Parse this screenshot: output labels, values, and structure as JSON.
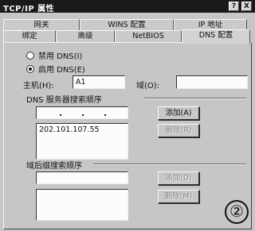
{
  "window": {
    "title": "TCP/IP 属性",
    "help_glyph": "?",
    "close_glyph": "X"
  },
  "tabs_back": [
    "网关",
    "WINS 配置",
    "IP 地址"
  ],
  "tabs_front": [
    "绑定",
    "高级",
    "NetBIOS",
    "DNS 配置"
  ],
  "dns": {
    "disable_label": "禁用 DNS(I)",
    "enable_label": "启用 DNS(E)",
    "enabled": true,
    "host_label": "主机(H):",
    "host_value": "A1",
    "domain_label": "域(O):",
    "domain_value": ""
  },
  "server_order": {
    "title": "DNS 服务器搜索顺序",
    "ip_dots": [
      ".",
      ".",
      "."
    ],
    "list": [
      "202.101.107.55"
    ],
    "add_label": "添加(A)",
    "delete_label": "删除(R)"
  },
  "suffix_order": {
    "title": "域后缀搜索顺序",
    "input_value": "",
    "list": [],
    "add_label": "添加(D)",
    "delete_label": "删除(M)"
  },
  "marker": "②"
}
